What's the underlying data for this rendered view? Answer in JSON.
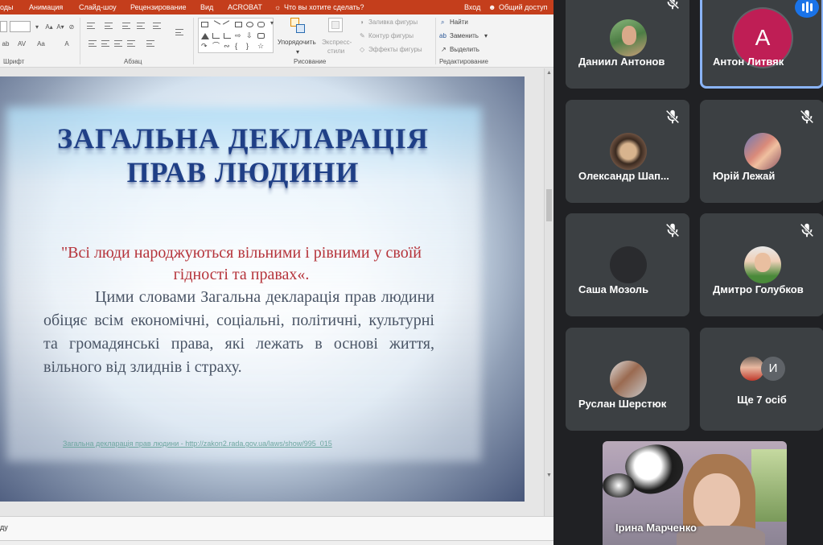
{
  "ribbon": {
    "tabs": [
      "оды",
      "Анимация",
      "Слайд-шоу",
      "Рецензирование",
      "Вид",
      "ACROBAT",
      "Что вы хотите сделать?",
      "Вход",
      "Общий доступ"
    ],
    "groups": {
      "font": "Шрифт",
      "paragraph": "Абзац",
      "drawing": "Рисование",
      "editing": "Редактирование"
    },
    "buttons": {
      "arrange": "Упорядочить",
      "quick_styles_1": "Экспресс-",
      "quick_styles_2": "стили",
      "shape_fill": "Заливка фигуры",
      "shape_outline": "Контур фигуры",
      "shape_effects": "Эффекты фигуры",
      "find": "Найти",
      "replace": "Заменить",
      "select": "Выделить"
    }
  },
  "slide": {
    "title_line1": "ЗАГАЛЬНА ДЕКЛАРАЦІЯ",
    "title_line2": "ПРАВ ЛЮДИНИ",
    "quote": "\"Всі люди народжуються вільними і рівними у своїй гідності та правах«.",
    "body": "Цими словами Загальна декларація прав людини обіцяє всім економічні, соціальні, політичні, культурні та громадянські права, які лежать в основі життя, вільного від злиднів і страху.",
    "link": "Загальна декларація прав людини - http://zakon2.rada.gov.ua/laws/show/995_015"
  },
  "notes": {
    "text": "ду"
  },
  "participants": [
    {
      "name": "Даниил Антонов",
      "muted": true,
      "speaking": false,
      "avatar": "photo"
    },
    {
      "name": "Антон Литвяк",
      "muted": false,
      "speaking": true,
      "avatar": "letter",
      "letter": "А"
    },
    {
      "name": "Олександр Шап...",
      "muted": true,
      "speaking": false,
      "avatar": "photo"
    },
    {
      "name": "Юрій Лежай",
      "muted": true,
      "speaking": false,
      "avatar": "photo"
    },
    {
      "name": "Саша Мозоль",
      "muted": true,
      "speaking": false,
      "avatar": "blank"
    },
    {
      "name": "Дмитро Голубков",
      "muted": true,
      "speaking": false,
      "avatar": "photo"
    },
    {
      "name": "Руслан Шерстюк",
      "muted": false,
      "speaking": false,
      "avatar": "photo"
    }
  ],
  "more": {
    "label": "Ще 7 осіб",
    "letter": "И"
  },
  "self_view": {
    "name": "Ірина Марченко"
  },
  "colors": {
    "ppt_accent": "#c43e1c",
    "speaking_outline": "#8ab4f8",
    "avatar_letter_bg": "#bf1e55",
    "tile_bg": "#3c4043"
  },
  "icons": [
    "search-icon",
    "replace-icon",
    "select-icon",
    "mic-off-icon",
    "speaking-icon",
    "user-icon",
    "lightbulb-icon"
  ]
}
